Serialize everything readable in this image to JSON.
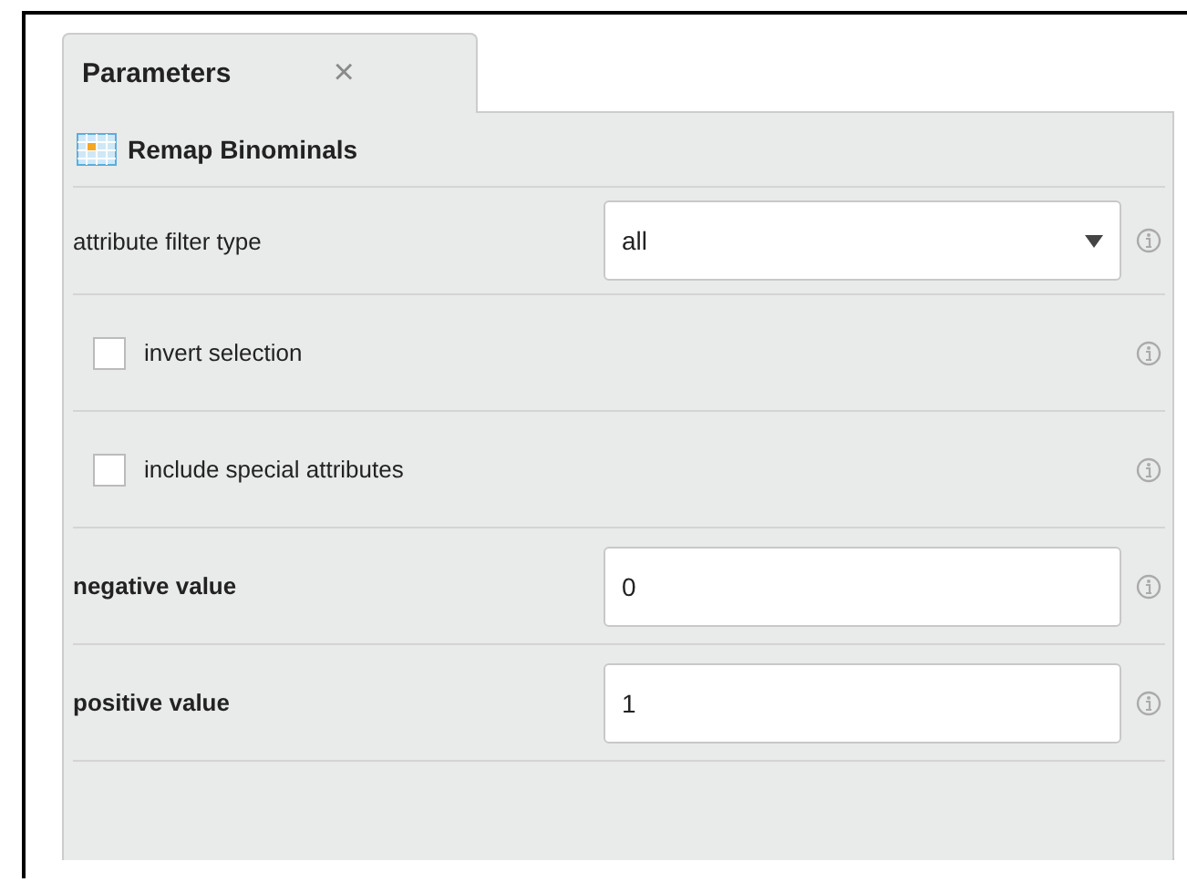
{
  "tab": {
    "label": "Parameters",
    "close": "×",
    "selected": true
  },
  "operator": {
    "title": "Remap Binominals"
  },
  "parameters": [
    {
      "kind": "select",
      "label": "attribute filter type",
      "bold": false,
      "value": "all"
    },
    {
      "kind": "checkbox",
      "label": "invert selection",
      "checked": false
    },
    {
      "kind": "checkbox",
      "label": "include special attributes",
      "checked": false
    },
    {
      "kind": "text",
      "label": "negative value",
      "bold": true,
      "value": "0"
    },
    {
      "kind": "text",
      "label": "positive value",
      "bold": true,
      "value": "1"
    }
  ]
}
